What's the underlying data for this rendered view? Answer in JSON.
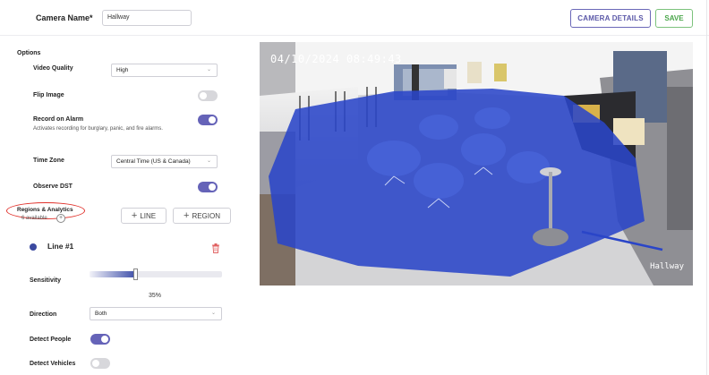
{
  "header": {
    "camera_name_label": "Camera Name*",
    "camera_name_value": "Hallway",
    "camera_details_label": "CAMERA DETAILS",
    "save_label": "SAVE"
  },
  "options": {
    "title": "Options",
    "video_quality": {
      "label": "Video Quality",
      "value": "High"
    },
    "flip_image": {
      "label": "Flip Image",
      "on": false
    },
    "record_on_alarm": {
      "label": "Record on Alarm",
      "description": "Activates recording for burglary, panic, and fire alarms.",
      "on": true
    },
    "time_zone": {
      "label": "Time Zone",
      "value": "Central Time (US & Canada)"
    },
    "observe_dst": {
      "label": "Observe DST",
      "on": true
    }
  },
  "regions": {
    "title": "Regions & Analytics",
    "available": "6 available",
    "add_line_label": "LINE",
    "add_region_label": "REGION"
  },
  "line": {
    "name": "Line #1",
    "sensitivity_label": "Sensitivity",
    "sensitivity_percent": 35,
    "sensitivity_text": "35%",
    "direction_label": "Direction",
    "direction_value": "Both",
    "detect_people": {
      "label": "Detect People",
      "on": true
    },
    "detect_vehicles": {
      "label": "Detect Vehicles",
      "on": false
    }
  },
  "video": {
    "timestamp": "04/10/2024 08:49:43",
    "camera_label": "Hallway"
  },
  "colors": {
    "accent": "#6563b8",
    "save_green": "#4aa64a",
    "region_blue": "#2a45c8",
    "annotation_red": "#e0302a",
    "delete_red": "#e06060"
  }
}
